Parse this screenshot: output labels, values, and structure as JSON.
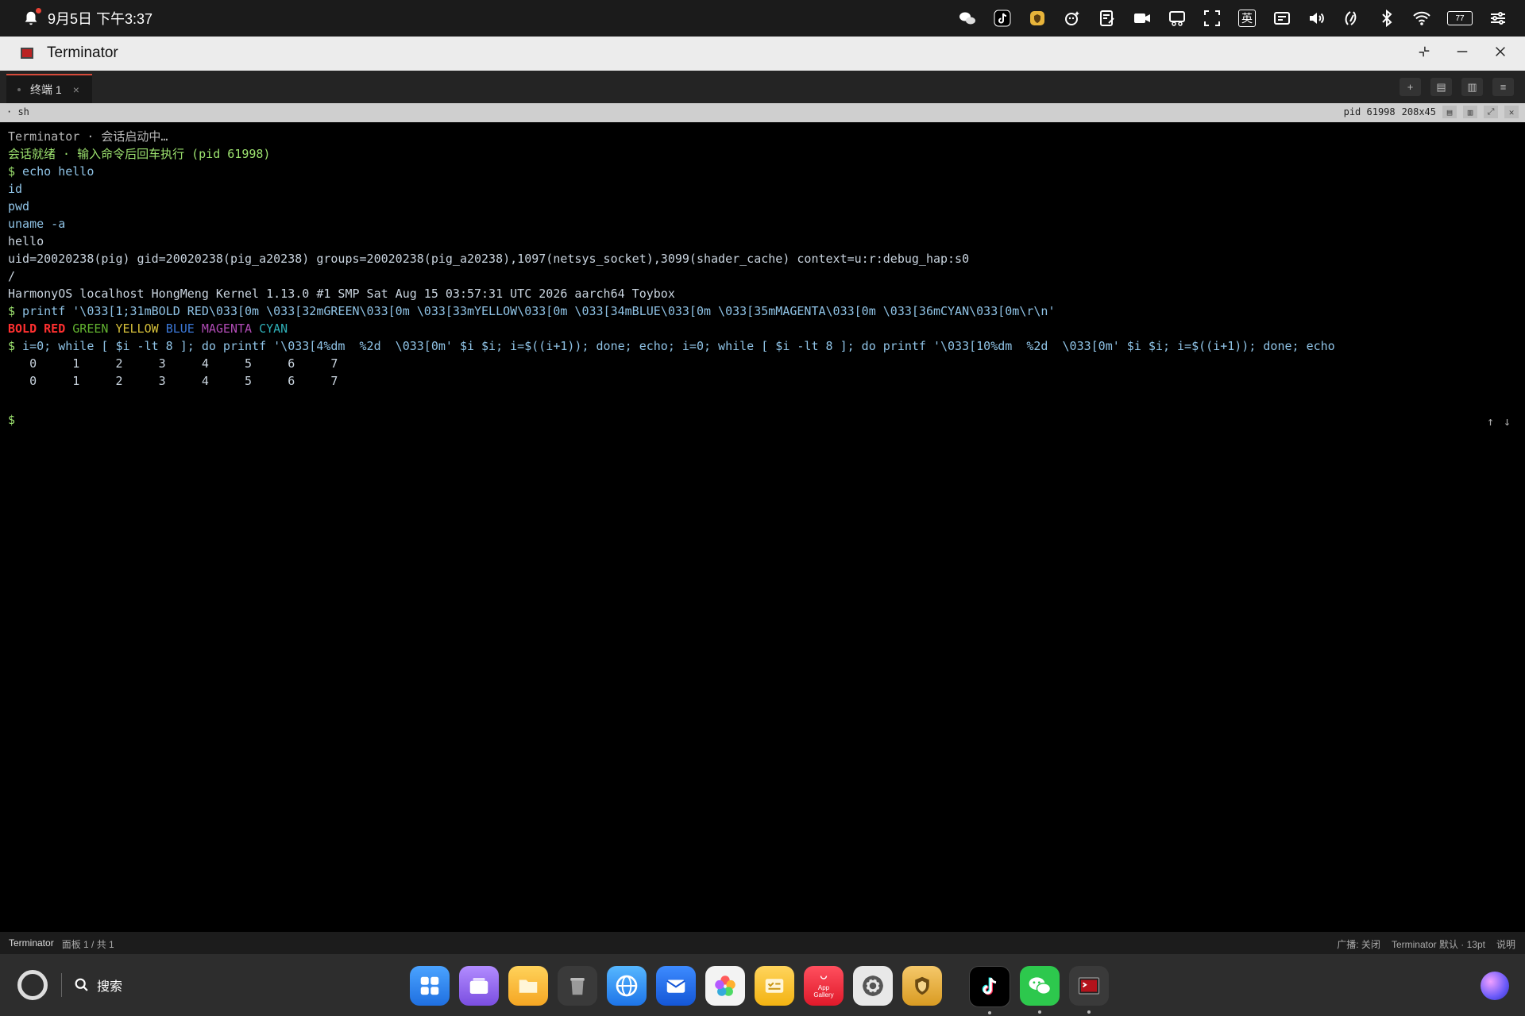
{
  "statusbar": {
    "datetime": "9月5日 下午3:37",
    "ime": "英",
    "battery": "77"
  },
  "window": {
    "title": "Terminator"
  },
  "tabs": [
    {
      "label": "终端 1",
      "close": "×"
    }
  ],
  "tab_tools": [
    "+",
    "▤",
    "▥",
    "≡"
  ],
  "pane": {
    "name": "sh",
    "pid": "pid 61998",
    "size": "208x45"
  },
  "terminal": {
    "line1": "Terminator · 会话启动中…",
    "line2": "会话就绪 · 输入命令后回车执行 (pid 61998)",
    "prompt": "$",
    "cmd1": " echo hello",
    "line_id": "id",
    "line_pwd": "pwd",
    "line_uname": "uname -a",
    "line_hello": "hello",
    "line_uid": "uid=20020238(pig) gid=20020238(pig_a20238) groups=20020238(pig_a20238),1097(netsys_socket),3099(shader_cache) context=u:r:debug_hap:s0",
    "line_slash": "/",
    "line_kernel": "HarmonyOS localhost HongMeng Kernel 1.13.0 #1 SMP Sat Aug 15 03:57:31 UTC 2026 aarch64 Toybox",
    "cmd2": " printf '\\033[1;31mBOLD RED\\033[0m \\033[32mGREEN\\033[0m \\033[33mYELLOW\\033[0m \\033[34mBLUE\\033[0m \\033[35mMAGENTA\\033[0m \\033[36mCYAN\\033[0m\\r\\n'",
    "colors": {
      "bold_red": "BOLD RED",
      "green": "GREEN",
      "yellow": "YELLOW",
      "blue": "BLUE",
      "magenta": "MAGENTA",
      "cyan": "CYAN"
    },
    "cmd3": " i=0; while [ $i -lt 8 ]; do printf '\\033[4%dm  %2d  \\033[0m' $i $i; i=$((i+1)); done; echo; i=0; while [ $i -lt 8 ]; do printf '\\033[10%dm  %2d  \\033[0m' $i $i; i=$((i+1)); done; echo",
    "row1": "   0     1     2     3     4     5     6     7",
    "row2": "   0     1     2     3     4     5     6     7",
    "scroll_up": "↑",
    "scroll_down": "↓"
  },
  "bottombar": {
    "app": "Terminator",
    "panes": "面板 1 / 共 1",
    "broadcast": "广播: 关闭",
    "profile": "Terminator 默认 · 13pt",
    "help": "说明"
  },
  "dock": {
    "search_label": "搜索",
    "app_gallery_label": "App Gallery",
    "apps": [
      "launcher",
      "multitask",
      "files",
      "trash",
      "browser",
      "mail",
      "photos",
      "notes",
      "app-gallery",
      "settings",
      "security",
      "tiktok",
      "wechat",
      "terminator"
    ]
  }
}
